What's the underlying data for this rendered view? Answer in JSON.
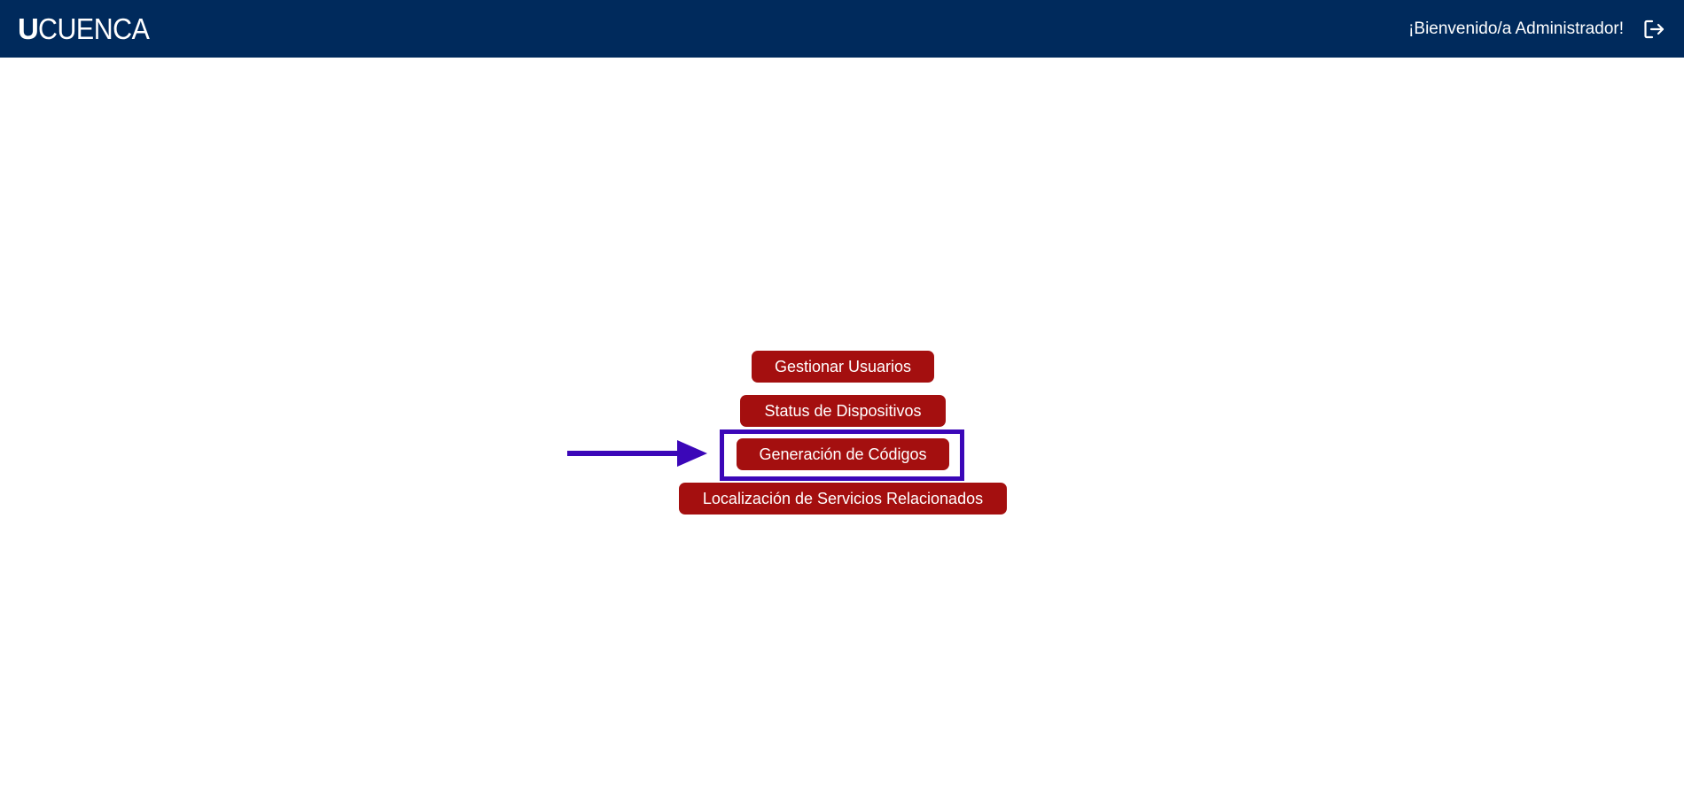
{
  "header": {
    "logo_u": "U",
    "logo_rest": "CUENCA",
    "welcome": "¡Bienvenido/a Administrador!",
    "logout_icon": "logout-icon",
    "background_color": "#002a5c"
  },
  "menu": {
    "items": [
      {
        "label": "Gestionar Usuarios"
      },
      {
        "label": "Status de Dispositivos"
      },
      {
        "label": "Generación de Códigos"
      },
      {
        "label": "Localización de Servicios Relacionados"
      }
    ],
    "button_color": "#a40f0f"
  },
  "annotation": {
    "highlighted_item": "Generación de Códigos",
    "color": "#3b07b8"
  }
}
